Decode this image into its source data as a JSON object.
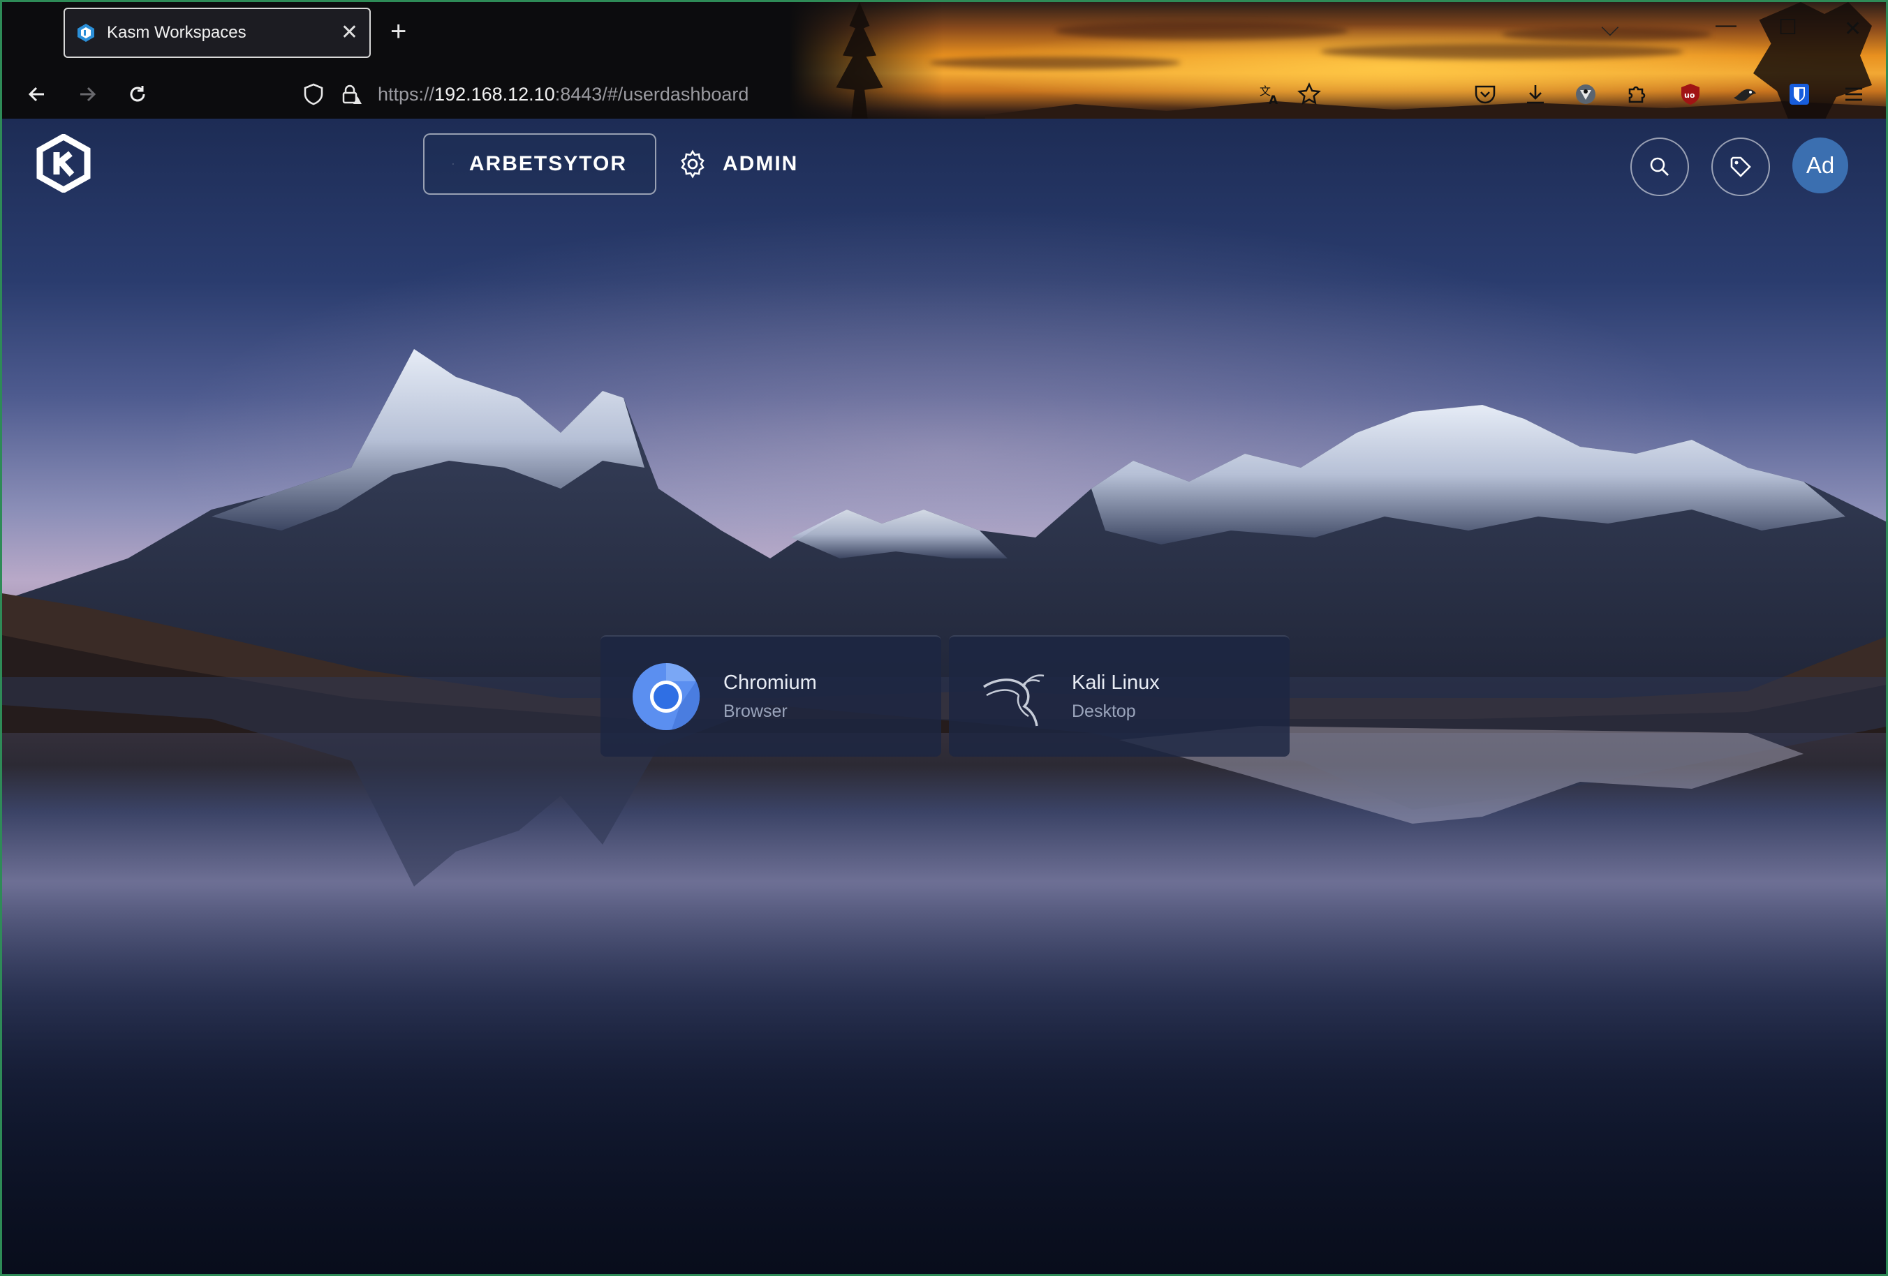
{
  "browser": {
    "tab": {
      "title": "Kasm Workspaces",
      "close": "✕"
    },
    "new_tab": "+",
    "url": {
      "scheme": "https://",
      "host": "192.168.12.10",
      "rest": ":8443/#/userdashboard"
    },
    "window_controls": {
      "minimize": "—",
      "maximize": "☐",
      "close": "✕",
      "dropdown": "⌵"
    },
    "toolbar_icons": [
      "translate-icon",
      "bookmark-star-icon",
      "pocket-icon",
      "download-icon",
      "privacy-badger-icon",
      "extensions-icon",
      "ublock-origin-icon",
      "extension-bird-icon",
      "bitwarden-icon",
      "menu-icon"
    ]
  },
  "header": {
    "nav": [
      {
        "label": "ARBETSYTOR",
        "icon": "layers-icon",
        "active": true
      },
      {
        "label": "ADMIN",
        "icon": "gear-icon",
        "active": false
      }
    ],
    "avatar": "Ad"
  },
  "workspaces": [
    {
      "name": "Chromium",
      "category": "Browser",
      "icon": "chromium-icon"
    },
    {
      "name": "Kali Linux",
      "category": "Desktop",
      "icon": "kali-dragon-icon"
    }
  ],
  "colors": {
    "accent": "#3b6fb0",
    "card_bg": "#1c2642",
    "window_border": "#2e8b57"
  }
}
